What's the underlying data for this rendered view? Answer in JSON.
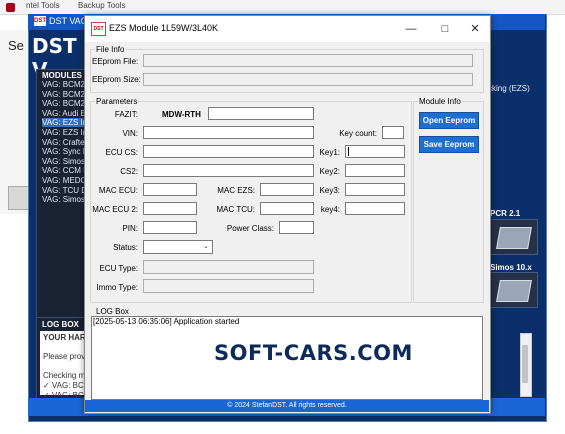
{
  "host": {
    "menu_1": "ntel Tools",
    "menu_2": "Backup Tools"
  },
  "left_window": {
    "title_fragment": "Se"
  },
  "main_window": {
    "title": "DST VAG",
    "banner": "DST V",
    "modules_header": "MODULES",
    "modules": [
      "VAG: BCM2",
      "VAG: BCM2",
      "VAG: BCM2",
      "VAG: Audi E",
      "VAG: EZS Im",
      "VAG: EZS Im",
      "VAG: Crafte",
      "VAG: Sync M",
      "VAG: Simos",
      "VAG: CCM M",
      "VAG: MEDC",
      "VAG: TCU D",
      "VAG: Simos"
    ],
    "selected_module_index": 4,
    "right_note": "cking (EZS)",
    "device_1_label": "PCR 2.1",
    "device_2_label": "Simos 10.x",
    "logbox_header": "LOG BOX",
    "logbox_lines": [
      "YOUR HAR",
      "",
      "Please prov",
      "",
      "Checking m",
      "✓ VAG: BCM",
      "✓ VAG: BCM"
    ]
  },
  "dialog": {
    "title": "EZS Module 1L59W/3L40K",
    "controls": {
      "minimize": "—",
      "maximize": "□",
      "close": "✕"
    },
    "file_info": {
      "group_label": "File Info",
      "eeprom_file_label": "EEprom File:",
      "eeprom_file_value": "",
      "eeprom_size_label": "EEprom Size:",
      "eeprom_size_value": ""
    },
    "parameters": {
      "group_label": "Parameters",
      "fazit_label": "FAZIT:",
      "fazit_value": "MDW-RTH",
      "vin_label": "VIN:",
      "ecu_cs_label": "ECU CS:",
      "cs2_label": "CS2:",
      "mac_ecu_label": "MAC ECU:",
      "mac_ezs_label": "MAC EZS:",
      "mac_ecu2_label": "MAC ECU 2:",
      "mac_tcu_label": "MAC TCU:",
      "pin_label": "PIN:",
      "power_class_label": "Power Class:",
      "status_label": "Status:",
      "status_value": "",
      "ecu_type_label": "ECU Type:",
      "immo_type_label": "Immo Type:",
      "key_count_label": "Key count:",
      "key1_label": "Key1:",
      "key2_label": "Key2:",
      "key3_label": "Key3:",
      "key4_label": "key4:"
    },
    "module_info": {
      "group_label": "Module Info",
      "open_button": "Open Eeprom",
      "save_button": "Save Eeprom"
    },
    "log": {
      "group_label": "LOG Box",
      "lines": [
        "[2025-05-13 06:35:06] Application started"
      ]
    },
    "footer": "© 2024 StefanDST. All rights reserved."
  },
  "watermark": "SOFT-CARS.COM",
  "colors": {
    "accent_blue": "#1f6fd0",
    "main_bg": "#0b2f6b",
    "footer_blue": "#1a66d8"
  }
}
